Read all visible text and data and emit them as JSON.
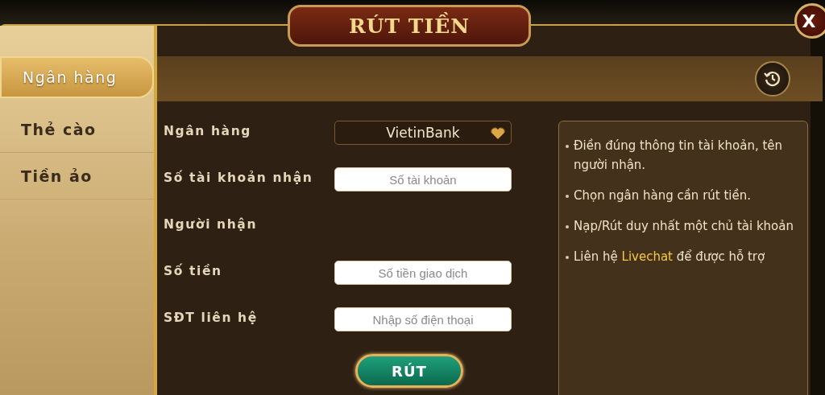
{
  "window": {
    "title": "RÚT TIỀN",
    "close": "X"
  },
  "tabs": [
    {
      "label": "Ngân hàng",
      "selected": true
    },
    {
      "label": "Thẻ cào",
      "selected": false
    },
    {
      "label": "Tiền ảo",
      "selected": false
    }
  ],
  "form": [
    {
      "label": "Ngân hàng",
      "kind": "select",
      "value": "VietinBank"
    },
    {
      "label": "Số tài khoản nhận",
      "kind": "input",
      "placeholder": "Số tài khoản"
    },
    {
      "label": "Người nhận",
      "kind": "text"
    },
    {
      "label": "Số tiền",
      "kind": "input",
      "placeholder": "Số tiền giao dịch"
    },
    {
      "label": "SĐT liên hệ",
      "kind": "input",
      "placeholder": "Nhập số điện thoại"
    }
  ],
  "submit": "RÚT",
  "notes": [
    {
      "text": "Điền đúng thông tin tài khoản, tên người nhận."
    },
    {
      "text": "Chọn ngân hàng cần rút tiền."
    },
    {
      "text": "Nạp/Rút duy nhất một chủ tài khoản"
    },
    {
      "text": "Liên hệ ",
      "link": "Livechat",
      "after": " để được hỗ trợ"
    }
  ]
}
